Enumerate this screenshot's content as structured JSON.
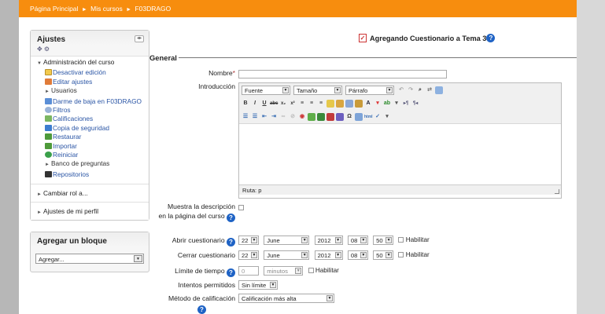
{
  "breadcrumb": [
    "Página Principal",
    "Mis cursos",
    "F03DRAGO"
  ],
  "settings_block": {
    "title": "Ajustes",
    "admin_label": "Administración del curso",
    "items": [
      {
        "label": "Desactivar edición",
        "icon": "edit-toggle-icon"
      },
      {
        "label": "Editar ajustes",
        "icon": "edit-settings-icon"
      },
      {
        "label": "Usuarios",
        "icon": "expand-arrow-icon"
      },
      {
        "label": "Darme de baja en F03DRAGO",
        "icon": "unenrol-icon"
      },
      {
        "label": "Filtros",
        "icon": "filter-icon"
      },
      {
        "label": "Calificaciones",
        "icon": "grades-icon"
      },
      {
        "label": "Copia de seguridad",
        "icon": "backup-icon"
      },
      {
        "label": "Restaurar",
        "icon": "restore-icon"
      },
      {
        "label": "Importar",
        "icon": "import-icon"
      },
      {
        "label": "Reiniciar",
        "icon": "reset-icon"
      },
      {
        "label": "Banco de preguntas",
        "icon": "expand-arrow-icon"
      },
      {
        "label": "Repositorios",
        "icon": "repository-icon"
      }
    ],
    "switch_role": "Cambiar rol a...",
    "profile": "Ajustes de mi perfil"
  },
  "add_block": {
    "title": "Agregar un bloque",
    "select_value": "Agregar..."
  },
  "form": {
    "title": "Agregando Cuestionario a Tema 3",
    "legend": "General",
    "name_label": "Nombre",
    "intro_label": "Introducción",
    "editor": {
      "font": "Fuente",
      "size": "Tamaño",
      "format": "Párrafo",
      "path": "Ruta: p"
    },
    "show_desc_label_1": "Muestra la descripción",
    "show_desc_label_2": "en la página del curso",
    "open_label": "Abrir cuestionario",
    "close_label": "Cerrar cuestionario",
    "open": {
      "day": "22",
      "month": "June",
      "year": "2012",
      "hour": "08",
      "minute": "50",
      "enable": "Habilitar"
    },
    "close": {
      "day": "22",
      "month": "June",
      "year": "2012",
      "hour": "08",
      "minute": "50",
      "enable": "Habilitar"
    },
    "time_limit_label": "Límite de tiempo",
    "time_limit_value": "0",
    "time_limit_unit": "minutos",
    "time_limit_enable": "Habilitar",
    "attempts_label": "Intentos permitidos",
    "attempts_value": "Sin límite",
    "grading_label": "Método de calificación",
    "grading_value": "Calificación más alta"
  },
  "colors": {
    "topbar": "#f78d0e",
    "link": "#2a55a5",
    "help": "#1f63c5"
  }
}
